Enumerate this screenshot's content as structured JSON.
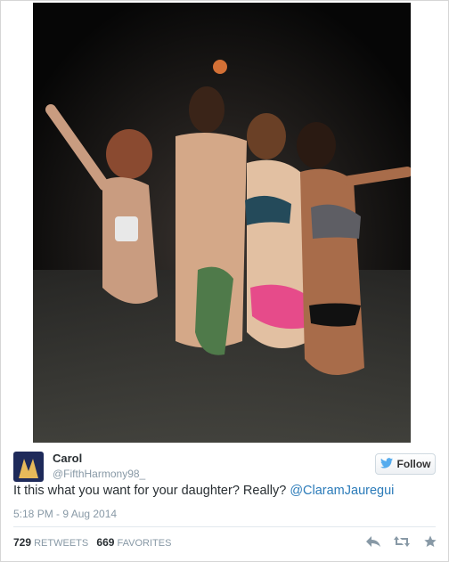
{
  "tweet": {
    "display_name": "Carol",
    "handle": "@FifthHarmony98_",
    "follow_label": "Follow",
    "text_before_mention": "It this what you want for your daughter? Really? ",
    "mention": "@ClaramJauregui",
    "timestamp": "5:18 PM - 9 Aug 2014",
    "retweets_count": "729",
    "retweets_label": "RETWEETS",
    "favorites_count": "669",
    "favorites_label": "FAVORITES"
  },
  "icons": {
    "follow": "twitter-bird-icon",
    "reply": "reply-icon",
    "retweet": "retweet-icon",
    "favorite": "star-icon"
  },
  "colors": {
    "link": "#2b7bb9",
    "muted": "#8899a6",
    "text": "#292f33"
  }
}
